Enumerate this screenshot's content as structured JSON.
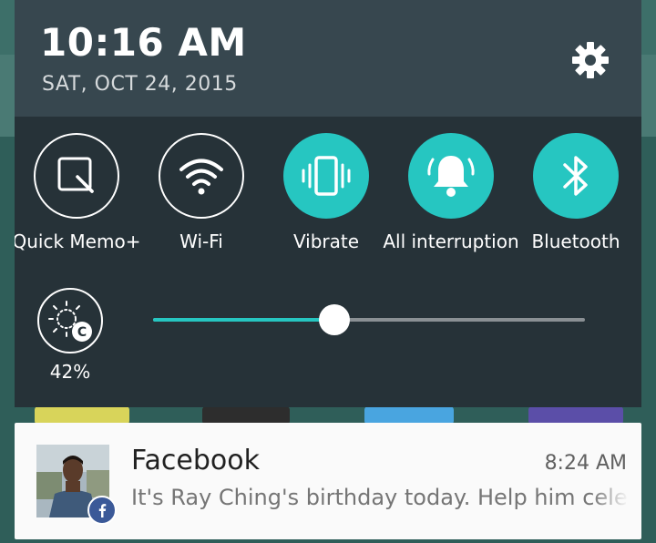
{
  "status": {
    "time": "10:16 AM",
    "date": "SAT, OCT 24, 2015"
  },
  "quick_settings": [
    {
      "label": "Quick Memo+",
      "icon": "quick-memo-icon",
      "state": "off"
    },
    {
      "label": "Wi-Fi",
      "icon": "wifi-icon",
      "state": "off"
    },
    {
      "label": "Vibrate",
      "icon": "vibrate-icon",
      "state": "on"
    },
    {
      "label": "All interruption",
      "icon": "bell-icon",
      "state": "on"
    },
    {
      "label": "Bluetooth",
      "icon": "bluetooth-icon",
      "state": "on"
    }
  ],
  "brightness": {
    "percent_label": "42%",
    "slider_value": 0.42
  },
  "notification": {
    "app": "Facebook",
    "time": "8:24 AM",
    "text": "It's Ray Ching's birthday today. Help him celebrate!"
  },
  "colors": {
    "accent": "#26c6c1",
    "panel": "#263238",
    "header": "#37474f",
    "facebook": "#3b5998"
  }
}
